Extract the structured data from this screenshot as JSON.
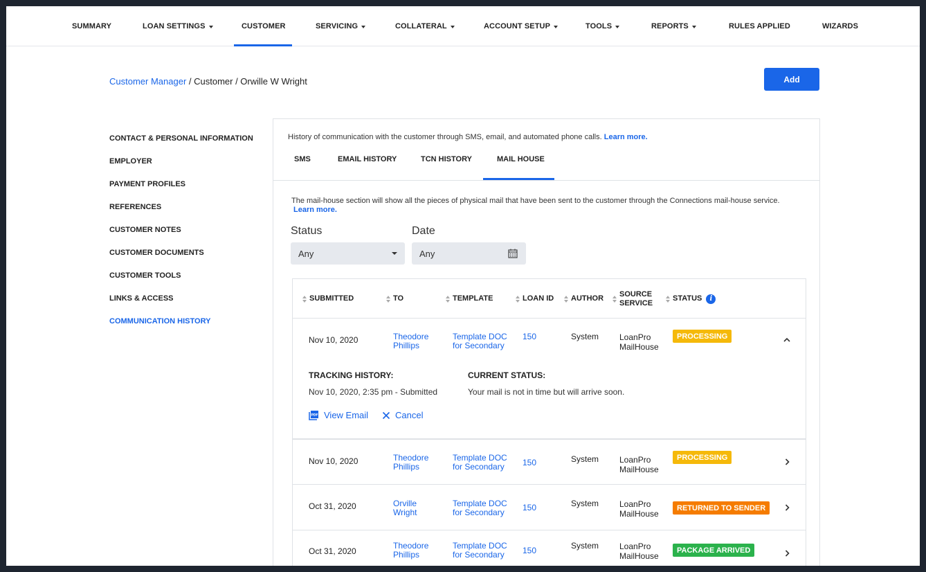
{
  "nav": {
    "items": [
      {
        "label": "SUMMARY",
        "dropdown": false
      },
      {
        "label": "LOAN SETTINGS",
        "dropdown": true
      },
      {
        "label": "CUSTOMER",
        "dropdown": false,
        "active": true
      },
      {
        "label": "SERVICING",
        "dropdown": true
      },
      {
        "label": "COLLATERAL",
        "dropdown": true
      },
      {
        "label": "ACCOUNT SETUP",
        "dropdown": true
      },
      {
        "label": "TOOLS",
        "dropdown": true
      },
      {
        "label": "REPORTS",
        "dropdown": true
      },
      {
        "label": "RULES APPLIED",
        "dropdown": false
      },
      {
        "label": "WIZARDS",
        "dropdown": false
      }
    ]
  },
  "breadcrumb": {
    "root": "Customer Manager",
    "rest": " / Customer / Orwille W Wright"
  },
  "add_button": "Add",
  "side_menu": [
    {
      "label": "CONTACT & PERSONAL INFORMATION"
    },
    {
      "label": "EMPLOYER"
    },
    {
      "label": "PAYMENT PROFILES"
    },
    {
      "label": "REFERENCES"
    },
    {
      "label": "CUSTOMER NOTES"
    },
    {
      "label": "CUSTOMER DOCUMENTS"
    },
    {
      "label": "CUSTOMER TOOLS"
    },
    {
      "label": "LINKS & ACCESS"
    },
    {
      "label": "COMMUNICATION HISTORY",
      "active": true
    }
  ],
  "panel": {
    "intro": "History of communication with the customer through SMS, email, and automated phone calls. ",
    "intro_link": "Learn more.",
    "tabs": [
      {
        "label": "SMS"
      },
      {
        "label": "EMAIL HISTORY"
      },
      {
        "label": "TCN HISTORY"
      },
      {
        "label": "MAIL HOUSE",
        "active": true
      }
    ],
    "section_desc": "The mail-house section will show all the pieces of physical mail that have been sent to the customer through the Connections mail-house service.",
    "section_link": "Learn more."
  },
  "filters": {
    "status_label": "Status",
    "status_value": "Any",
    "date_label": "Date",
    "date_value": "Any"
  },
  "table": {
    "headers": {
      "submitted": "SUBMITTED",
      "to": "TO",
      "template": "TEMPLATE",
      "loan_id": "LOAN ID",
      "author": "AUTHOR",
      "source_line1": "SOURCE",
      "source_line2": "SERVICE",
      "status": "STATUS"
    },
    "rows": [
      {
        "submitted": "Nov 10, 2020",
        "to1": "Theodore",
        "to2": "Phillips",
        "tpl1": "Template DOC",
        "tpl2": "for Secondary",
        "loan_id": "150",
        "author": "System",
        "src1": "LoanPro",
        "src2": "MailHouse",
        "status": "PROCESSING",
        "status_color": "#f5b90a",
        "expanded": true
      },
      {
        "submitted": "Nov 10, 2020",
        "to1": "Theodore",
        "to2": "Phillips",
        "tpl1": "Template DOC",
        "tpl2": "for Secondary",
        "loan_id": "150",
        "author": "System",
        "src1": "LoanPro",
        "src2": "MailHouse",
        "status": "PROCESSING",
        "status_color": "#f5b90a"
      },
      {
        "submitted": "Oct 31, 2020",
        "to1": "Orville",
        "to2": "Wright",
        "tpl1": "Template DOC",
        "tpl2": "for Secondary",
        "loan_id": "150",
        "author": "System",
        "src1": "LoanPro",
        "src2": "MailHouse",
        "status": "RETURNED TO SENDER",
        "status_color": "#f57c00"
      },
      {
        "submitted": "Oct 31, 2020",
        "to1": "Theodore",
        "to2": "Phillips",
        "tpl1": "Template DOC",
        "tpl2": "for Secondary",
        "loan_id": "150",
        "author": "System",
        "src1": "LoanPro",
        "src2": "MailHouse",
        "status": "PACKAGE ARRIVED",
        "status_color": "#2bb24c"
      }
    ],
    "detail": {
      "tracking_title": "TRACKING HISTORY:",
      "tracking_entry": "Nov 10, 2020, 2:35 pm - Submitted",
      "current_title": "CURRENT STATUS:",
      "current_text": "Your mail is not in time but will arrive soon.",
      "view_email": "View Email",
      "cancel": "Cancel"
    }
  }
}
